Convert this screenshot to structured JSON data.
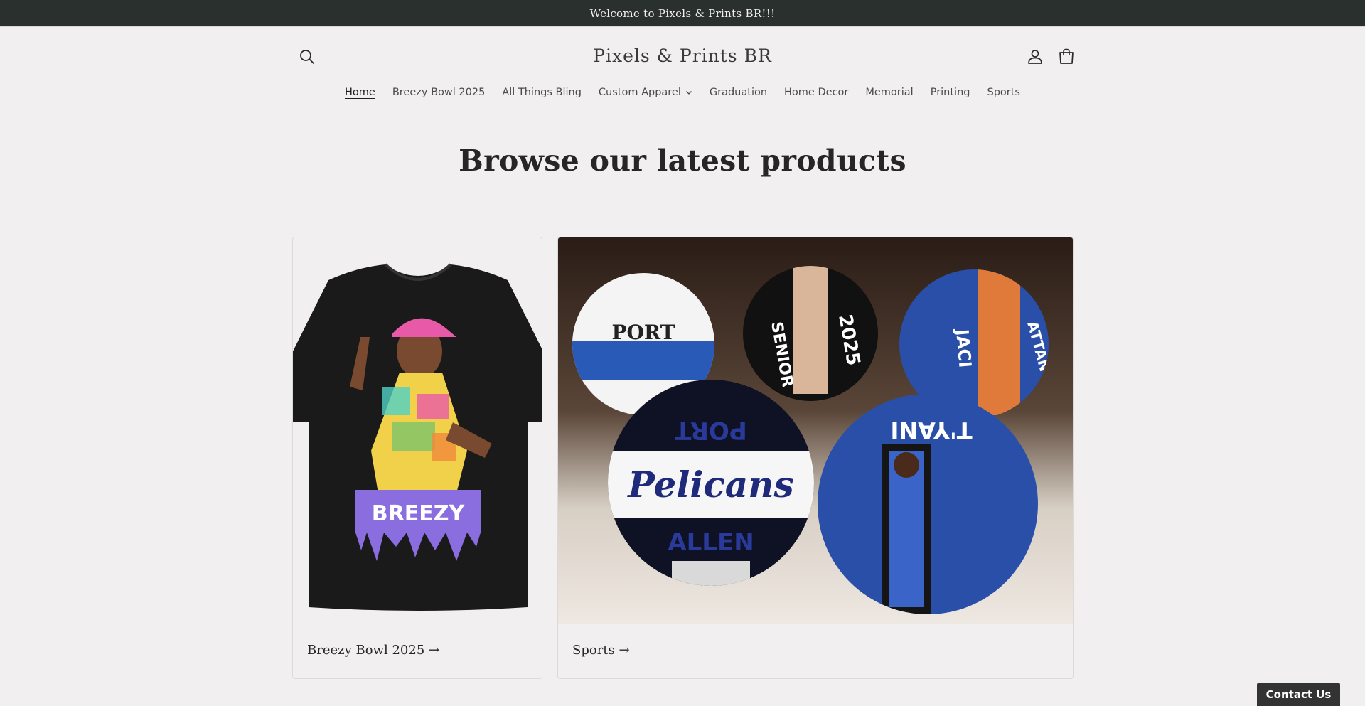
{
  "announcement": {
    "text": "Welcome to Pixels & Prints BR!!!"
  },
  "header": {
    "logo": "Pixels & Prints BR",
    "search_icon": "search-icon",
    "account_icon": "account-icon",
    "cart_icon": "cart-icon"
  },
  "nav": {
    "items": [
      {
        "label": "Home",
        "active": true
      },
      {
        "label": "Breezy Bowl 2025"
      },
      {
        "label": "All Things Bling"
      },
      {
        "label": "Custom Apparel",
        "has_dropdown": true
      },
      {
        "label": "Graduation"
      },
      {
        "label": "Home Decor"
      },
      {
        "label": "Memorial"
      },
      {
        "label": "Printing"
      },
      {
        "label": "Sports"
      }
    ]
  },
  "section": {
    "title": "Browse our latest products"
  },
  "collections": [
    {
      "caption": "Breezy Bowl 2025 →",
      "image_text": "BREEZY"
    },
    {
      "caption": "Sports →",
      "image_text": [
        "PORT",
        "Pelicans",
        "ALLEN",
        "T'YANI",
        "SENIOR",
        "2025",
        "JACI",
        "ATTAN"
      ]
    }
  ],
  "contact": {
    "label": "Contact Us"
  },
  "colors": {
    "announcement_bg": "#2a302e",
    "page_bg": "#f1eff0",
    "text": "#262626",
    "blue_ball": "#2a4fa8"
  }
}
